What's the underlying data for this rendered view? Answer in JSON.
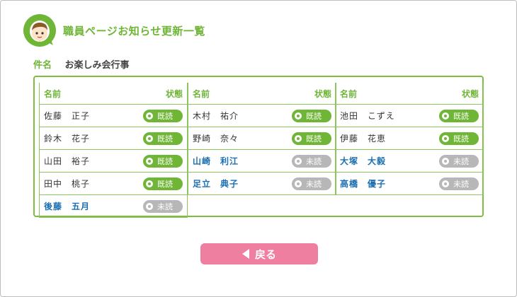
{
  "header": {
    "title": "職員ページお知らせ更新一覧"
  },
  "subject": {
    "label": "件名",
    "value": "お楽しみ会行事"
  },
  "table": {
    "name_header": "名前",
    "status_header": "状態",
    "read_label": "既読",
    "unread_label": "未読",
    "columns": [
      {
        "rows": [
          {
            "name": "佐藤　正子",
            "read": true
          },
          {
            "name": "鈴木　花子",
            "read": true
          },
          {
            "name": "山田　裕子",
            "read": true
          },
          {
            "name": "田中　桃子",
            "read": true
          },
          {
            "name": "後藤　五月",
            "read": false
          }
        ]
      },
      {
        "rows": [
          {
            "name": "木村　祐介",
            "read": true
          },
          {
            "name": "野崎　奈々",
            "read": true
          },
          {
            "name": "山崎　利江",
            "read": false
          },
          {
            "name": "足立　典子",
            "read": false
          }
        ]
      },
      {
        "rows": [
          {
            "name": "池田　こずえ",
            "read": true
          },
          {
            "name": "伊藤　花恵",
            "read": true
          },
          {
            "name": "大塚　大毅",
            "read": false
          },
          {
            "name": "高橋　優子",
            "read": false
          }
        ]
      }
    ]
  },
  "back_button": {
    "label": "戻る"
  }
}
